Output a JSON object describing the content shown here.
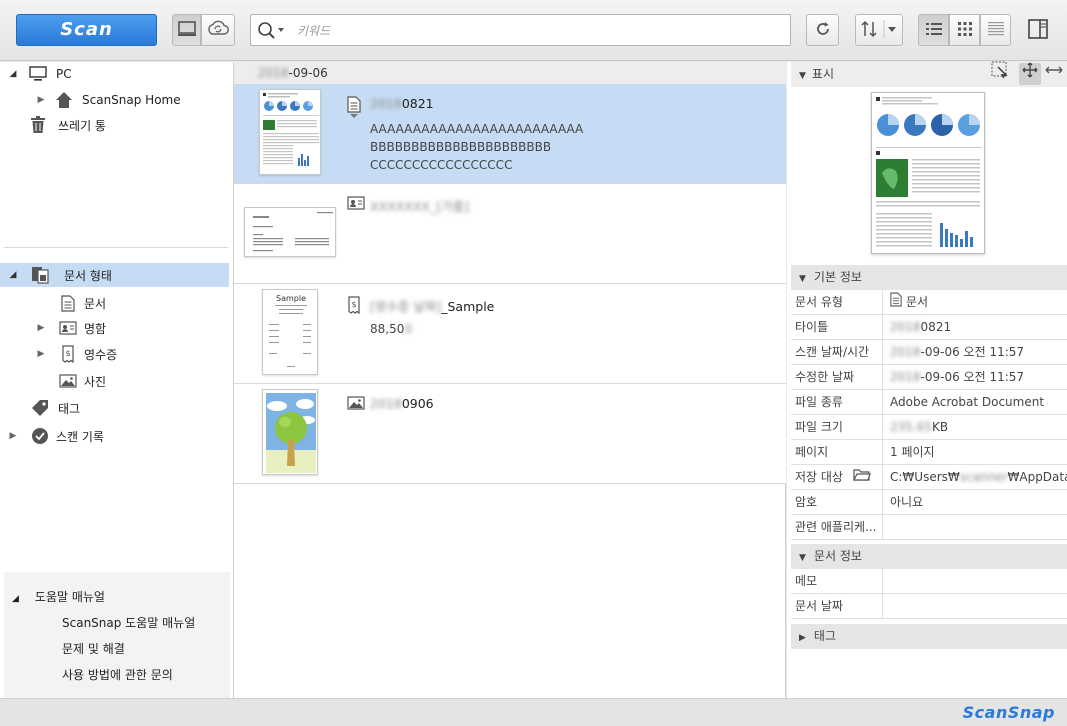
{
  "toolbar": {
    "scan_label": "Scan",
    "search_placeholder": "키워드"
  },
  "sidebar": {
    "pc_label": "PC",
    "scansnap_home_label": "ScanSnap Home",
    "trash_label": "쓰레기 통",
    "doc_type_label": "문서 형태",
    "doc_type_items": [
      "문서",
      "명함",
      "영수증",
      "사진"
    ],
    "tag_label": "태그",
    "scan_history_label": "스캔 기록",
    "help_manual_label": "도움말 매뉴얼",
    "help_items": [
      "ScanSnap 도움말 매뉴얼",
      "문제 및 해결",
      "사용 방법에 관한 문의"
    ]
  },
  "list": {
    "date_header_blur": "2018",
    "date_header": "-09-06",
    "items": [
      {
        "title_blur": "2018",
        "title": "0821",
        "lines": [
          "AAAAAAAAAAAAAAAAAAAAAAAAA",
          "BBBBBBBBBBBBBBBBBBBBBB",
          "CCCCCCCCCCCCCCCCC"
        ]
      },
      {
        "title_blur": "XXXXXXX_[가품]",
        "title": ""
      },
      {
        "title_blur": "[영수증 날짜]",
        "title": "_Sample",
        "amount": "88,50",
        "amount_blur": "0"
      },
      {
        "title_blur": "2018",
        "title": "0906"
      }
    ],
    "receipt_thumb_title": "Sample"
  },
  "preview": {
    "section_label": "표시"
  },
  "basic_info": {
    "section_label": "기본 정보",
    "rows": [
      {
        "key": "문서 유형",
        "value": "문서"
      },
      {
        "key": "타이틀",
        "value_blur": "2018",
        "value": "0821"
      },
      {
        "key": "스캔 날짜/시간",
        "value_blur": "2018",
        "value": "-09-06 오전 11:57"
      },
      {
        "key": "수정한 날짜",
        "value_blur": "2018",
        "value": "-09-06 오전 11:57"
      },
      {
        "key": "파일 종류",
        "value": "Adobe Acrobat Document"
      },
      {
        "key": "파일 크기",
        "value_blur": "235.65",
        "value": "KB"
      },
      {
        "key": "페이지",
        "value": "1 페이지"
      },
      {
        "key": "저장 대상",
        "value": "C:₩Users₩",
        "value_blur": "scanner",
        "value_tail": "₩AppData₩..."
      },
      {
        "key": "암호",
        "value": "아니요"
      },
      {
        "key": "관련 애플리케...",
        "value": ""
      }
    ]
  },
  "doc_info": {
    "section_label": "문서 정보",
    "rows": [
      {
        "key": "메모",
        "value": ""
      },
      {
        "key": "문서 날짜",
        "value": ""
      }
    ]
  },
  "tag_section": {
    "section_label": "태그"
  },
  "status": {
    "logo": "ScanSnap"
  },
  "colors": {
    "accent": "#2a7ad8",
    "selection": "#c6dcf4"
  }
}
